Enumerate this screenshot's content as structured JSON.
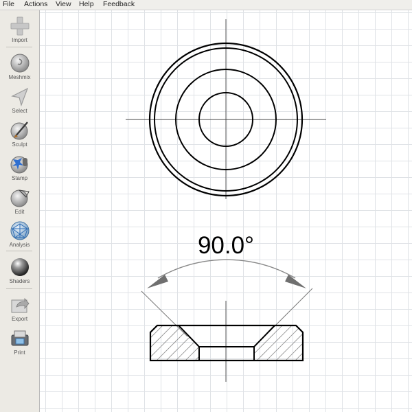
{
  "menu": [
    "File",
    "Actions",
    "View",
    "Help",
    "Feedback"
  ],
  "tools": [
    {
      "icon": "plus-icon",
      "label": "Import"
    },
    {
      "icon": "meshmix-icon",
      "label": "Meshmix"
    },
    {
      "icon": "select-arrow-icon",
      "label": "Select"
    },
    {
      "icon": "sculpt-brush-icon",
      "label": "Sculpt"
    },
    {
      "icon": "stamp-icon",
      "label": "Stamp"
    },
    {
      "icon": "edit-icon",
      "label": "Edit"
    },
    {
      "icon": "analysis-icon",
      "label": "Analysis"
    },
    {
      "icon": "shaders-icon",
      "label": "Shaders"
    },
    {
      "icon": "export-icon",
      "label": "Export"
    },
    {
      "icon": "print-icon",
      "label": "Print"
    }
  ],
  "drawing": {
    "angle_label": "90.0°"
  }
}
